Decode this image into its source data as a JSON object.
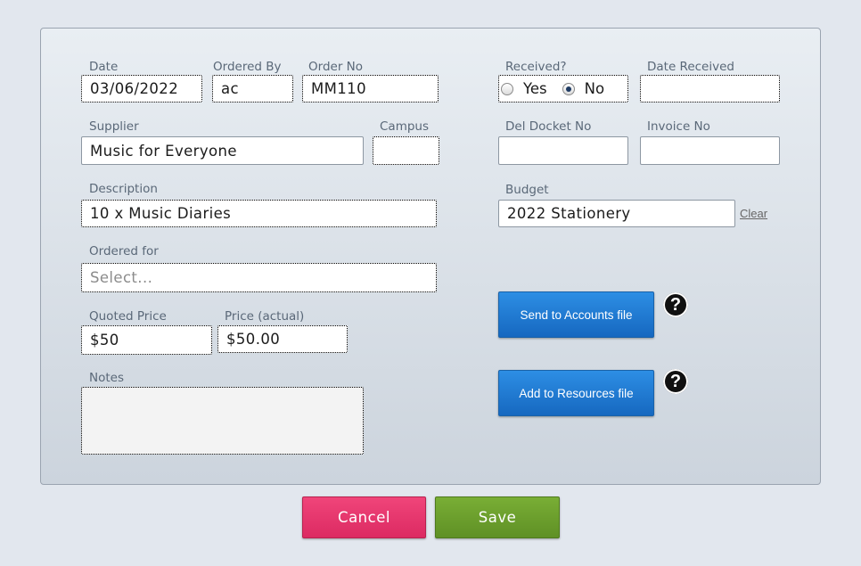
{
  "form": {
    "date": {
      "label": "Date",
      "value": "03/06/2022"
    },
    "ordered_by": {
      "label": "Ordered By",
      "value": "ac"
    },
    "order_no": {
      "label": "Order No",
      "value": "MM110"
    },
    "supplier": {
      "label": "Supplier",
      "value": "Music for Everyone"
    },
    "campus": {
      "label": "Campus",
      "value": ""
    },
    "description": {
      "label": "Description",
      "value": "10 x Music Diaries"
    },
    "ordered_for": {
      "label": "Ordered for",
      "placeholder": "Select..."
    },
    "quoted_price": {
      "label": "Quoted Price",
      "value": "$50"
    },
    "price_actual": {
      "label": "Price (actual)",
      "value": "$50.00"
    },
    "notes": {
      "label": "Notes",
      "value": ""
    },
    "received": {
      "label": "Received?",
      "options": [
        "Yes",
        "No"
      ],
      "selected": "No"
    },
    "date_received": {
      "label": "Date Received",
      "value": ""
    },
    "del_docket_no": {
      "label": "Del Docket No",
      "value": ""
    },
    "invoice_no": {
      "label": "Invoice No",
      "value": ""
    },
    "budget": {
      "label": "Budget",
      "value": "2022 Stationery",
      "clear_label": "Clear"
    }
  },
  "actions": {
    "send_accounts": "Send to Accounts file",
    "add_resources": "Add to Resources file",
    "help_glyph": "?",
    "cancel": "Cancel",
    "save": "Save"
  },
  "colors": {
    "cancel": "#e8326a",
    "save": "#6a9f2c",
    "blue_button": "#1f7ad2"
  }
}
